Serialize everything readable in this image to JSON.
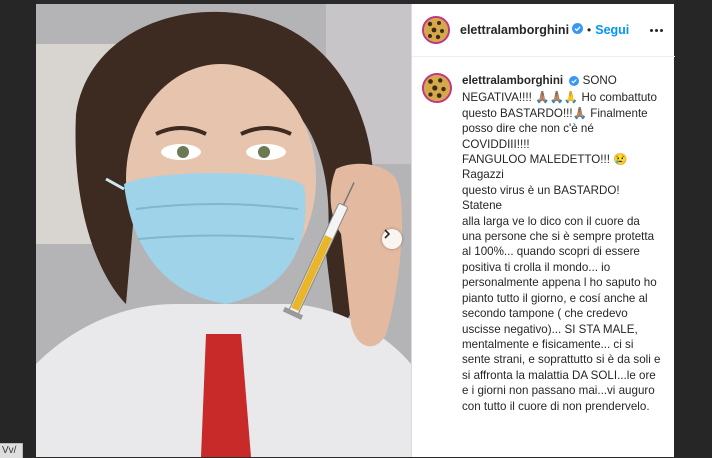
{
  "post": {
    "username": "elettralamborghini",
    "follow_label": "Segui",
    "separator": "•",
    "caption_user": "elettralamborghini",
    "caption_lines": [
      "SONO",
      "NEGATIVA!!!! 🙏🏽🙏🏽🙏 Ho combattuto",
      "questo BASTARDO!!!🙏🏽 Finalmente",
      "posso dire che non c'è né COVIDDIII!!!!",
      "FANGULOO MALEDETTO!!! 😢 Ragazzi",
      "questo virus è un BASTARDO! Statene",
      "alla larga ve lo dico con il cuore da",
      "una persone che si è sempre protetta",
      "al 100%... quando scopri di essere",
      "positiva ti crolla il mondo... io",
      "personalmente appena l ho saputo ho",
      "pianto tutto il giorno, e cosí anche al",
      "secondo tampone ( che credevo",
      "uscisse negativo)... SI STA MALE,",
      "mentalmente e fisicamente... ci si",
      "sente strani, e soprattutto si è da soli e",
      "si affronta la malattia DA SOLI...le ore",
      "e i giorni non passano mai...vi auguro",
      "con tutto il cuore di non prendervelo."
    ]
  },
  "status_bar": {
    "url_text": "Vv/"
  },
  "colors": {
    "accent": "#0095f6",
    "verified": "#3897f0",
    "text": "#262626"
  },
  "icons": {
    "verified": "verified-badge-icon",
    "more": "more-options-icon",
    "next": "chevron-right-icon"
  }
}
